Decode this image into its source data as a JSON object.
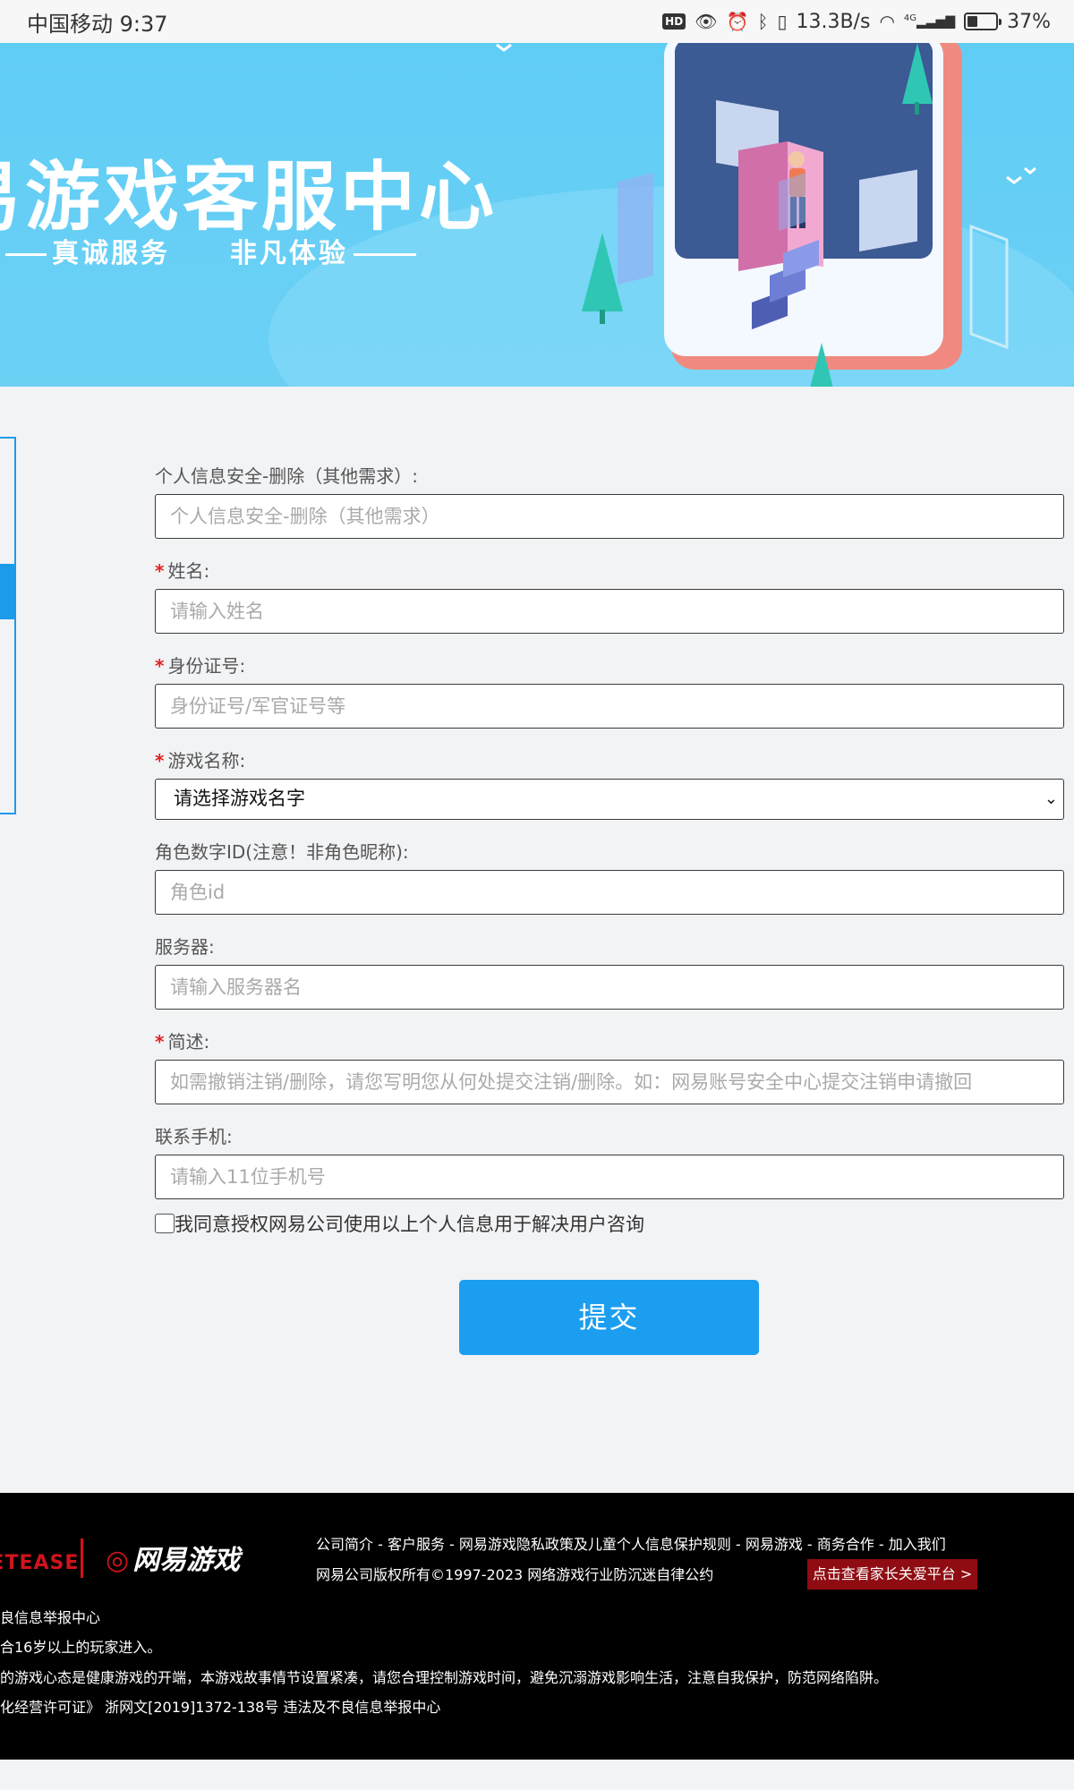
{
  "status_bar": {
    "carrier_time": "中国移动 9:37",
    "net_speed": "13.3B/s",
    "network_type": "4G",
    "battery": "37%",
    "battery_level": 0.37
  },
  "banner": {
    "title": "易游戏客服中心",
    "slogan_left": "真诚服务",
    "slogan_right": "非凡体验"
  },
  "form": {
    "request_type": {
      "label": "个人信息安全-删除（其他需求）:",
      "placeholder": "个人信息安全-删除（其他需求）"
    },
    "name": {
      "label": "姓名:",
      "placeholder": "请输入姓名",
      "required": true
    },
    "id_number": {
      "label": "身份证号:",
      "placeholder": "身份证号/军官证号等",
      "required": true
    },
    "game_name": {
      "label": "游戏名称:",
      "selected": "请选择游戏名字",
      "required": true
    },
    "role_id": {
      "label": "角色数字ID(注意！非角色昵称):",
      "placeholder": "角色id"
    },
    "server": {
      "label": "服务器:",
      "placeholder": "请输入服务器名"
    },
    "description": {
      "label": "简述:",
      "placeholder": "如需撤销注销/删除，请您写明您从何处提交注销/删除。如：网易账号安全中心提交注销申请撤回",
      "required": true
    },
    "phone": {
      "label": "联系手机:",
      "placeholder": "请输入11位手机号"
    },
    "agree_text": "我同意授权网易公司使用以上个人信息用于解决用户咨询",
    "submit_label": "提交"
  },
  "footer": {
    "logo_netease": "NETEASE",
    "logo_game": "网易游戏",
    "links": "公司简介 - 客户服务 - 网易游戏隐私政策及儿童个人信息保护规则 - 网易游戏 - 商务合作 - 加入我们",
    "copyright": "网易公司版权所有©1997-2023   网络游戏行业防沉迷自律公约",
    "parent_platform": "点击查看家长关爱平台 >",
    "line1": "良信息举报中心",
    "line2": "合16岁以上的玩家进入。",
    "line3": "的游戏心态是健康游戏的开端，本游戏故事情节设置紧凑，请您合理控制游戏时间，避免沉溺游戏影响生活，注意自我保护，防范网络陷阱。",
    "line4": "化经营许可证》 浙网文[2019]1372-138号 违法及不良信息举报中心"
  }
}
